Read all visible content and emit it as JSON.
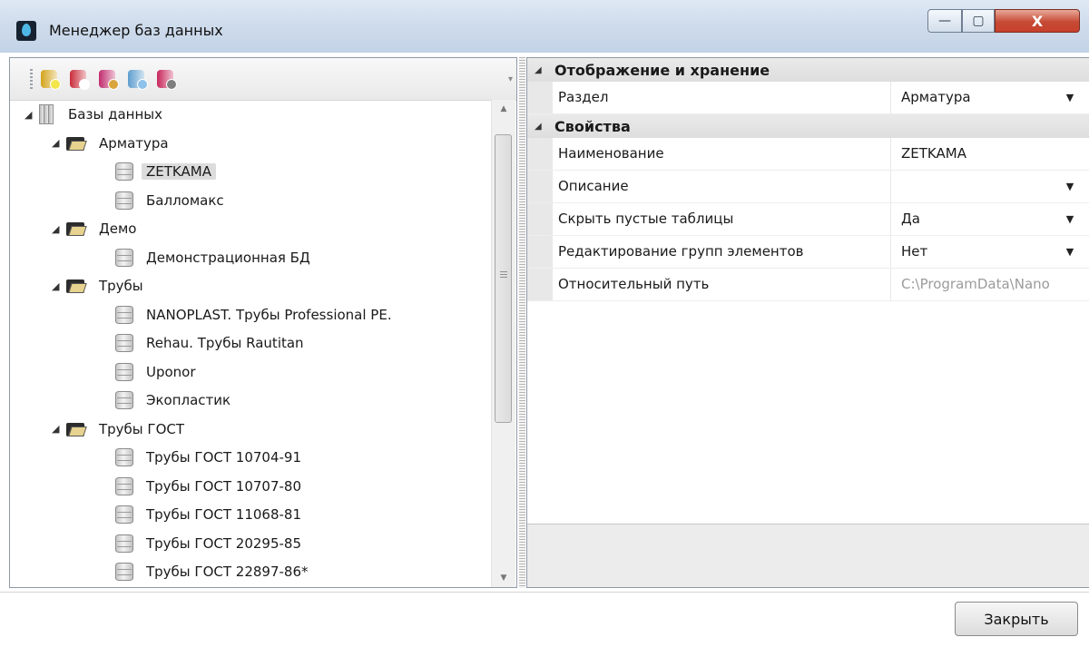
{
  "window": {
    "title": "Менеджер баз данных"
  },
  "title_buttons": {
    "minimize": "—",
    "maximize": "▢",
    "close": "X"
  },
  "toolbar": {
    "buttons": [
      {
        "name": "add-database-icon",
        "color": "#d3a31a",
        "badge": "#f3e64a"
      },
      {
        "name": "remove-database-icon",
        "color": "#c92c3b",
        "badge": "#ffffff"
      },
      {
        "name": "edit-database-icon",
        "color": "#c12c6e",
        "badge": "#d9a53d"
      },
      {
        "name": "refresh-icon",
        "color": "#5e9ecf",
        "badge": "#8fc2ea"
      },
      {
        "name": "database-settings-icon",
        "color": "#c7265b",
        "badge": "#7f7f7f"
      }
    ]
  },
  "tree": {
    "root_label": "Базы данных",
    "groups": [
      {
        "label": "Арматура",
        "items": [
          "ZETKAMA",
          "Балломакс"
        ]
      },
      {
        "label": "Демо",
        "items": [
          "Демонстрационная БД"
        ]
      },
      {
        "label": "Трубы",
        "items": [
          "NANOPLAST. Трубы Professional PE.",
          "Rehau. Трубы Rautitan",
          "Uponor",
          "Экопластик"
        ]
      },
      {
        "label": "Трубы ГОСТ",
        "items": [
          "Трубы ГОСТ 10704-91",
          "Трубы ГОСТ 10707-80",
          "Трубы ГОСТ 11068-81",
          "Трубы ГОСТ 20295-85",
          "Трубы ГОСТ 22897-86*"
        ]
      }
    ],
    "selected": "ZETKAMA"
  },
  "properties": {
    "category_display": "Отображение и хранение",
    "section_label": "Раздел",
    "section_value": "Арматура",
    "category_properties": "Свойства",
    "rows": [
      {
        "label": "Наименование",
        "value": "ZETKAMA",
        "dropdown": false
      },
      {
        "label": "Описание",
        "value": "",
        "dropdown": true
      },
      {
        "label": "Скрыть пустые таблицы",
        "value": "Да",
        "dropdown": true
      },
      {
        "label": "Редактирование групп элементов",
        "value": "Нет",
        "dropdown": true
      },
      {
        "label": "Относительный путь",
        "value": "C:\\ProgramData\\Nano",
        "dropdown": false,
        "muted": true
      }
    ]
  },
  "footer": {
    "close_label": "Закрыть"
  }
}
